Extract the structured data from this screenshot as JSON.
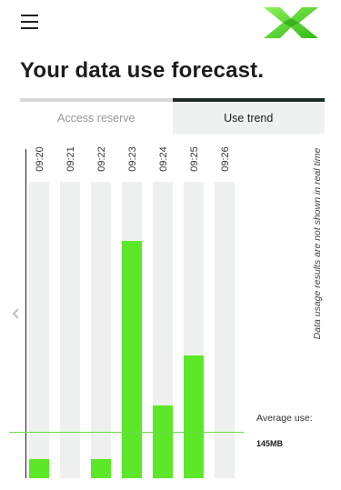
{
  "header": {
    "menu_icon": "hamburger-menu-icon",
    "logo_icon": "x-logo-icon"
  },
  "page": {
    "title": "Your data use forecast."
  },
  "tabs": [
    {
      "label": "Access reserve",
      "active": false
    },
    {
      "label": "Use trend",
      "active": true
    }
  ],
  "chart": {
    "prev_icon": "chevron-left-icon",
    "average_label": "Average use:",
    "average_value": "145MB",
    "note": "Data usage results are not shown in real time"
  },
  "colors": {
    "bar": "#5ce829",
    "track": "#eef0ef",
    "average_line": "#6bdb47",
    "active_tab_border": "#1e2d2a"
  },
  "chart_data": {
    "type": "bar",
    "categories": [
      "09:20",
      "09:21",
      "09:22",
      "09:23",
      "09:24",
      "09:25",
      "09:26"
    ],
    "values": [
      0.065,
      0,
      0.065,
      0.8,
      0.245,
      0.415,
      0
    ],
    "average": 0.155,
    "ylim": [
      0,
      1
    ]
  }
}
